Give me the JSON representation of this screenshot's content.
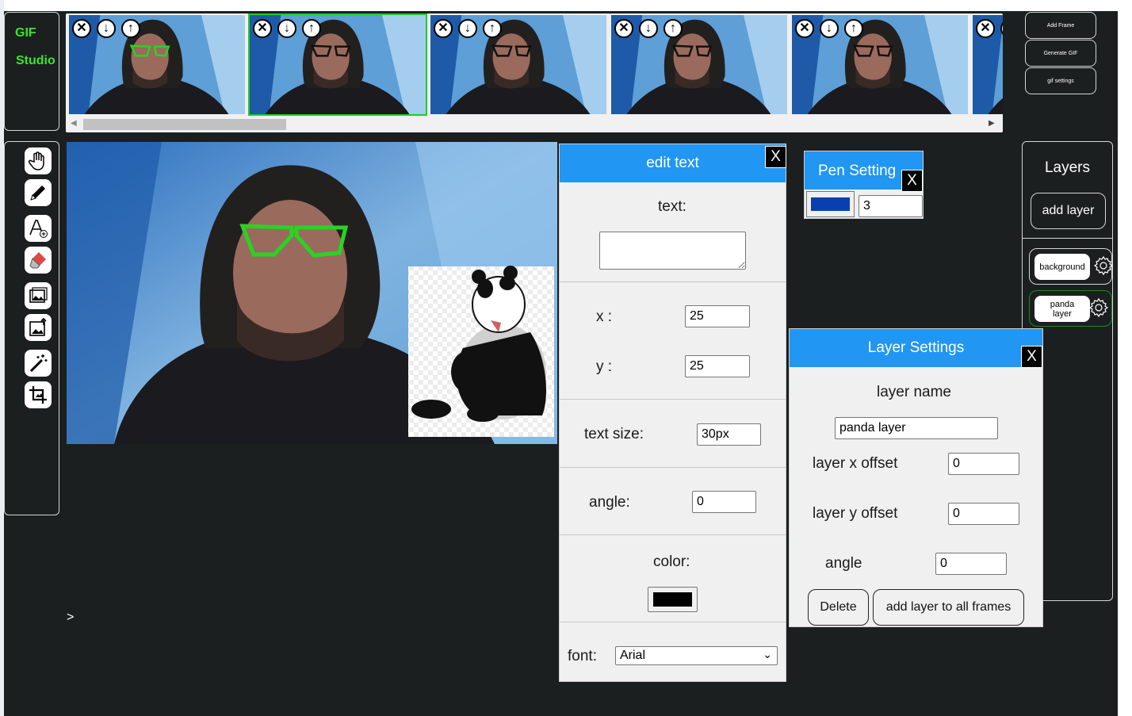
{
  "app": {
    "logo_line1": "GIF",
    "logo_line2": "Studio"
  },
  "frames": {
    "controls": {
      "delete": "✕",
      "move_down": "↓",
      "move_up": "↑"
    },
    "count_visible": 6,
    "selected_index": 1
  },
  "actions": {
    "add_frame": "Add Frame",
    "generate_gif": "Generate GIF",
    "gif_settings": "gif settings"
  },
  "toolbar": {
    "tools": [
      "hand-icon",
      "pencil-icon",
      "add-text-icon",
      "eraser-icon",
      "add-image-icon",
      "upload-image-icon",
      "magic-wand-icon",
      "crop-icon"
    ]
  },
  "edit_text": {
    "title": "edit text",
    "close": "X",
    "text_label": "text:",
    "text_value": "",
    "x_label": "x :",
    "x_value": "25",
    "y_label": "y :",
    "y_value": "25",
    "size_label": "text size:",
    "size_value": "30px",
    "angle_label": "angle:",
    "angle_value": "0",
    "color_label": "color:",
    "color_value": "#000000",
    "font_label": "font:",
    "font_value": "Arial"
  },
  "pen_settings": {
    "title": "Pen Setting",
    "close": "X",
    "color_value": "#0a3fb0",
    "size_value": "3"
  },
  "layers": {
    "title": "Layers",
    "add_layer": "add layer",
    "items": [
      {
        "name": "background",
        "active": false
      },
      {
        "name": "panda layer",
        "active": true
      }
    ]
  },
  "layer_settings": {
    "title": "Layer Settings",
    "close": "X",
    "name_label": "layer name",
    "name_value": "panda layer",
    "x_offset_label": "layer x offset",
    "x_offset_value": "0",
    "y_offset_label": "layer y offset",
    "y_offset_value": "0",
    "angle_label": "angle",
    "angle_value": "0",
    "delete": "Delete",
    "add_to_all": "add layer to all frames"
  },
  "misc": {
    "caret": ">"
  },
  "colors": {
    "accent": "#2196f3",
    "logo_green": "#39e62a",
    "selected_frame": "#1ccc28",
    "background": "#1b1f1f"
  }
}
